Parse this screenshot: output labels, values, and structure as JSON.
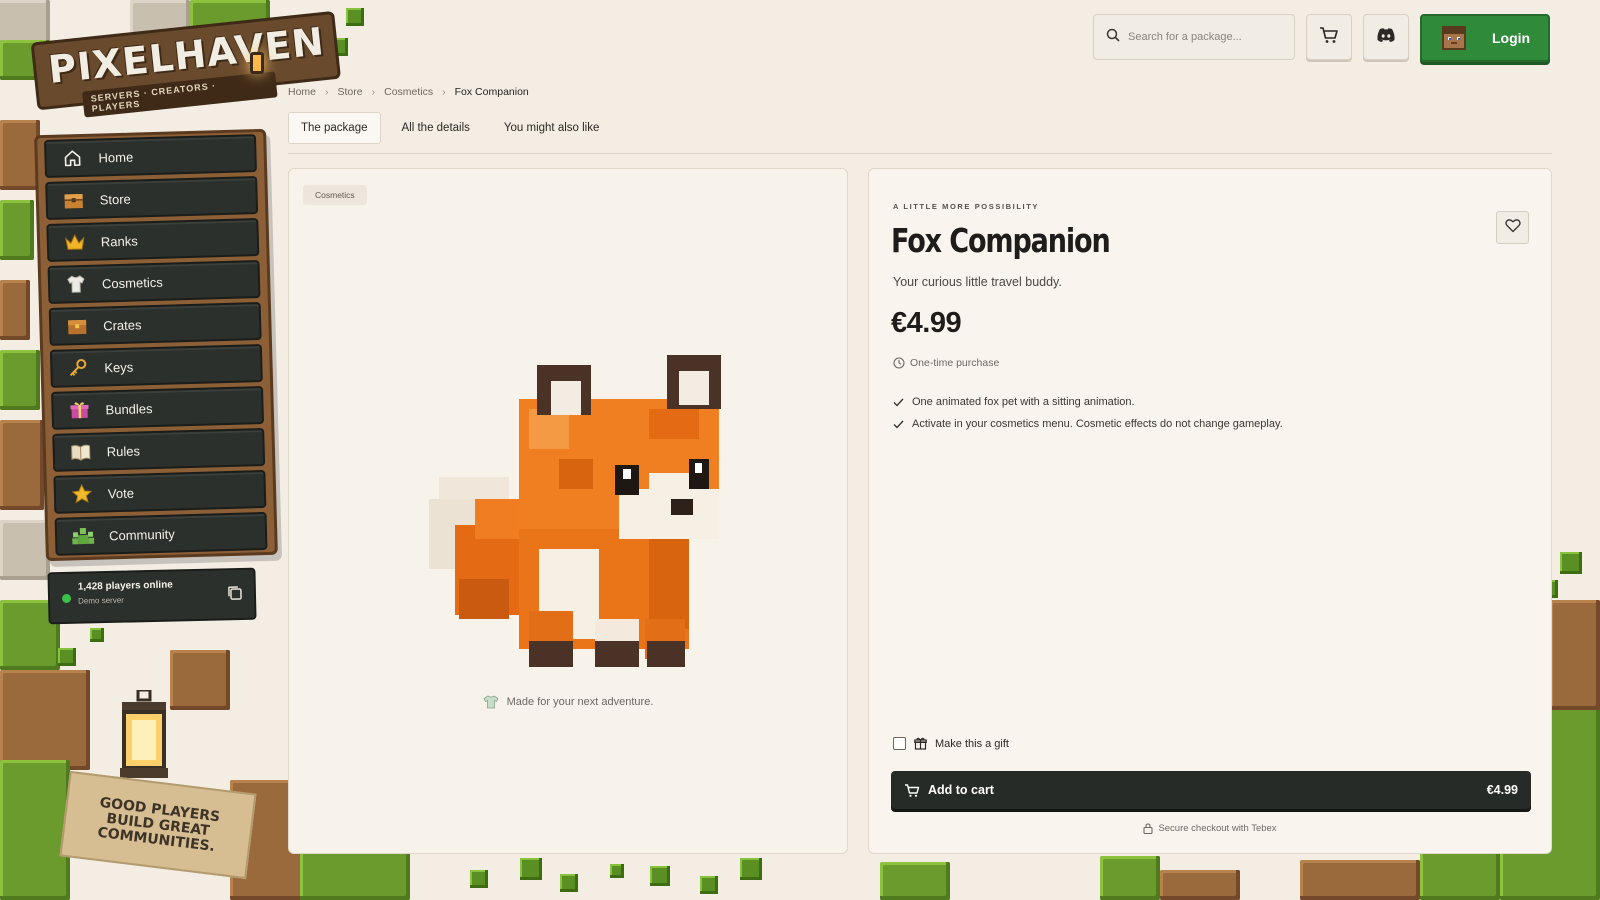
{
  "brand": {
    "name": "PIXELHAVEN",
    "tagline": "SERVERS · CREATORS · PLAYERS"
  },
  "header": {
    "search_placeholder": "Search for a package...",
    "cart_icon": "cart-icon",
    "discord_icon": "discord-icon",
    "login_label": "Login"
  },
  "sidebar": {
    "items": [
      {
        "label": "Home",
        "icon": "home-icon"
      },
      {
        "label": "Store",
        "icon": "chest-icon"
      },
      {
        "label": "Ranks",
        "icon": "crown-icon"
      },
      {
        "label": "Cosmetics",
        "icon": "shirt-icon"
      },
      {
        "label": "Crates",
        "icon": "crate-icon"
      },
      {
        "label": "Keys",
        "icon": "key-icon"
      },
      {
        "label": "Bundles",
        "icon": "gift-icon"
      },
      {
        "label": "Rules",
        "icon": "book-icon"
      },
      {
        "label": "Vote",
        "icon": "star-icon"
      },
      {
        "label": "Community",
        "icon": "people-icon"
      }
    ],
    "status": {
      "players": "1,428 players online",
      "server": "Demo server"
    },
    "sign_text": "GOOD PLAYERS BUILD GREAT COMMUNITIES."
  },
  "breadcrumb": [
    "Home",
    "Store",
    "Cosmetics",
    "Fox Companion"
  ],
  "tabs": [
    "The package",
    "All the details",
    "You might also like"
  ],
  "product": {
    "category_badge": "Cosmetics",
    "caption": "Made for your next adventure.",
    "kicker": "A LITTLE MORE POSSIBILITY",
    "title": "Fox Companion",
    "subtitle": "Your curious little travel buddy.",
    "price": "€4.99",
    "purchase_type": "One-time purchase",
    "features": [
      "One animated fox pet with a sitting animation.",
      "Activate in your cosmetics menu. Cosmetic effects do not change gameplay."
    ],
    "gift_label": "Make this a gift",
    "add_to_cart_label": "Add to cart",
    "add_to_cart_price": "€4.99",
    "secure_text": "Secure checkout with Tebex"
  },
  "colors": {
    "accent_green": "#2f8a3a",
    "sidebar_dark": "#2c302d",
    "background": "#f3ede4",
    "online_dot": "#38c24a"
  }
}
